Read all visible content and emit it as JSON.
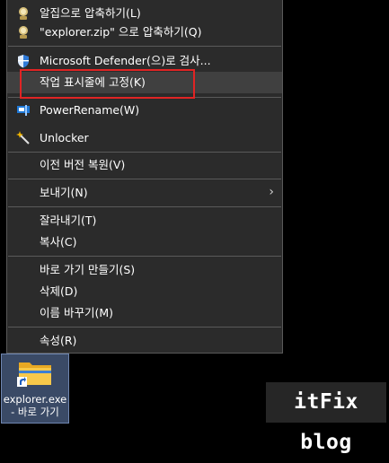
{
  "menu": {
    "items": [
      {
        "label": "알집으로 압축하기(L)",
        "icon": "alzip-icon"
      },
      {
        "label": "\"explorer.zip\" 으로 압축하기(Q)",
        "icon": "alzip-icon"
      },
      {
        "label": "Microsoft Defender(으)로 검사...",
        "icon": "defender-shield-icon"
      },
      {
        "label": "작업 표시줄에 고정(K)",
        "icon": ""
      },
      {
        "label": "PowerRename(W)",
        "icon": "powerrename-icon"
      },
      {
        "label": "Unlocker",
        "icon": "unlocker-wand-icon"
      },
      {
        "label": "이전 버전 복원(V)",
        "icon": ""
      },
      {
        "label": "보내기(N)",
        "icon": "",
        "submenu_indicator": "chevron-right-icon"
      },
      {
        "label": "잘라내기(T)",
        "icon": ""
      },
      {
        "label": "복사(C)",
        "icon": ""
      },
      {
        "label": "바로 가기 만들기(S)",
        "icon": ""
      },
      {
        "label": "삭제(D)",
        "icon": ""
      },
      {
        "label": "이름 바꾸기(M)",
        "icon": ""
      },
      {
        "label": "속성(R)",
        "icon": ""
      }
    ],
    "hovered_item": "작업 표시줄에 고정(K)"
  },
  "desktop_icon": {
    "label": "explorer.exe - 바로 가기",
    "icon": "folder-shortcut-icon"
  },
  "watermark": "itFix blog",
  "colors": {
    "menu_bg": "#2b2b2b",
    "menu_hover": "#404040",
    "separator": "#5a5a5a",
    "highlight_box": "#e02424",
    "desktop_bg": "#000000"
  }
}
